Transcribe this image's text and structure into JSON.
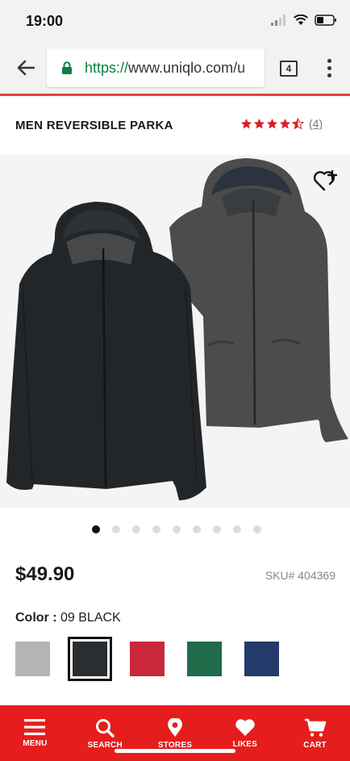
{
  "status_bar": {
    "time": "19:00",
    "icons": [
      "signal-icon",
      "wifi-icon",
      "battery-icon"
    ]
  },
  "browser": {
    "url_scheme": "https://",
    "url_host": "www.uniqlo.com/u",
    "tab_count": "4",
    "icons": [
      "back-arrow-icon",
      "lock-icon",
      "menu-dots-icon"
    ]
  },
  "accent_color": "#e8413a",
  "product": {
    "title": "MEN REVERSIBLE PARKA",
    "rating": 4.5,
    "review_count": "(4)",
    "price": "$49.90",
    "sku": "SKU# 404369",
    "color_key": "Color :",
    "color_value": "09 BLACK",
    "carousel": {
      "total": 9,
      "active": 0
    },
    "swatches": [
      {
        "color": "#b3b4b3",
        "selected": false
      },
      {
        "color": "#2a2e33",
        "selected": true
      },
      {
        "color": "#c9283a",
        "selected": false
      },
      {
        "color": "#1f6b4a",
        "selected": false
      },
      {
        "color": "#243a6a",
        "selected": false
      }
    ]
  },
  "bottom_nav": {
    "background": "#e61d1d",
    "items": [
      {
        "label": "MENU",
        "icon": "menu-icon"
      },
      {
        "label": "SEARCH",
        "icon": "search-icon"
      },
      {
        "label": "STORES",
        "icon": "location-pin-icon"
      },
      {
        "label": "LIKES",
        "icon": "heart-icon"
      },
      {
        "label": "CART",
        "icon": "cart-icon"
      }
    ]
  }
}
